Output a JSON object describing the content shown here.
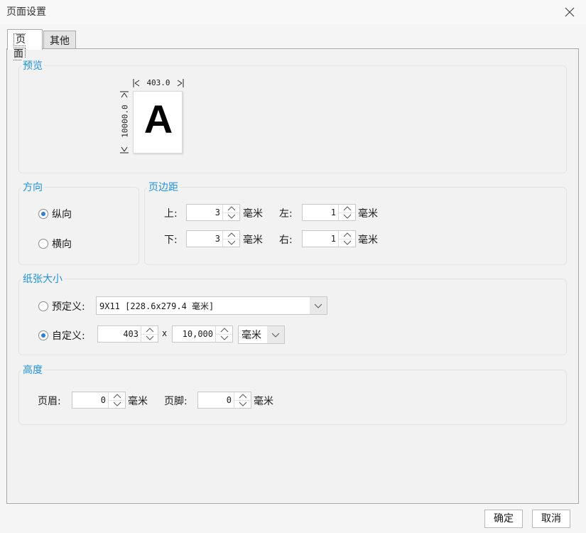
{
  "dialog": {
    "title": "页面设置"
  },
  "tabs": [
    {
      "label": "页面"
    },
    {
      "label": "其他"
    }
  ],
  "preview": {
    "title": "预览",
    "width_label": "403.0",
    "height_label": "10000.0",
    "letter": "A"
  },
  "orientation": {
    "title": "方向",
    "portrait": "纵向",
    "landscape": "横向",
    "selected": "portrait"
  },
  "margins": {
    "title": "页边距",
    "top_label": "上:",
    "top_value": "3",
    "left_label": "左:",
    "left_value": "1",
    "bottom_label": "下:",
    "bottom_value": "3",
    "right_label": "右:",
    "right_value": "1",
    "unit": "毫米"
  },
  "paper": {
    "title": "纸张大小",
    "predefined_label": "预定义:",
    "predefined_value": "9X11 [228.6x279.4 毫米]",
    "custom_label": "自定义:",
    "width_value": "403",
    "x_label": "x",
    "height_value": "10,000",
    "unit_value": "毫米",
    "selected": "custom"
  },
  "height": {
    "title": "高度",
    "header_label": "页眉:",
    "header_value": "0",
    "footer_label": "页脚:",
    "footer_value": "0",
    "unit": "毫米"
  },
  "buttons": {
    "ok": "确定",
    "cancel": "取消"
  }
}
